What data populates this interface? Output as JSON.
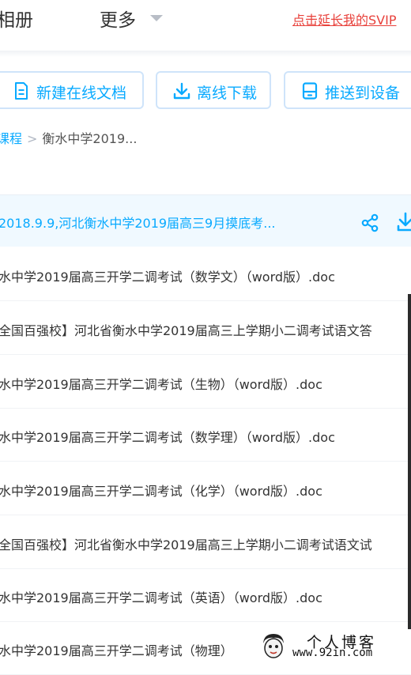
{
  "nav": {
    "photos_label": "相册",
    "more_label": "更多",
    "svip_link": "点击延长我的SVIP"
  },
  "toolbar": {
    "new_doc_label": "新建在线文档",
    "offline_download_label": "离线下载",
    "push_device_label": "推送到设备"
  },
  "breadcrumb": {
    "parent": "课程",
    "separator": ">",
    "current": "衡水中学2019..."
  },
  "selected_item": {
    "name": "2018.9.9,河北衡水中学2019届高三9月摸底考...",
    "actions": [
      "share-icon",
      "download-icon"
    ]
  },
  "files": [
    "水中学2019届高三开学二调考试（数学文）（word版）.doc",
    "全国百强校】河北省衡水中学2019届高三上学期小二调考试语文答",
    "水中学2019届高三开学二调考试（生物）（word版）.doc",
    "水中学2019届高三开学二调考试（数学理）（word版）.doc",
    "水中学2019届高三开学二调考试（化学）（word版）.doc",
    "全国百强校】河北省衡水中学2019届高三上学期小二调考试语文试",
    "水中学2019届高三开学二调考试（英语）（word版）.doc",
    "水中学2019届高三开学二调考试（物理）"
  ],
  "watermark": {
    "title": "个人博客",
    "url": "www.92in.com"
  },
  "colors": {
    "accent": "#09aaff",
    "svip_red": "#e8413b",
    "selected_bg": "#f0f9ff",
    "button_border": "#cfe4fa"
  }
}
